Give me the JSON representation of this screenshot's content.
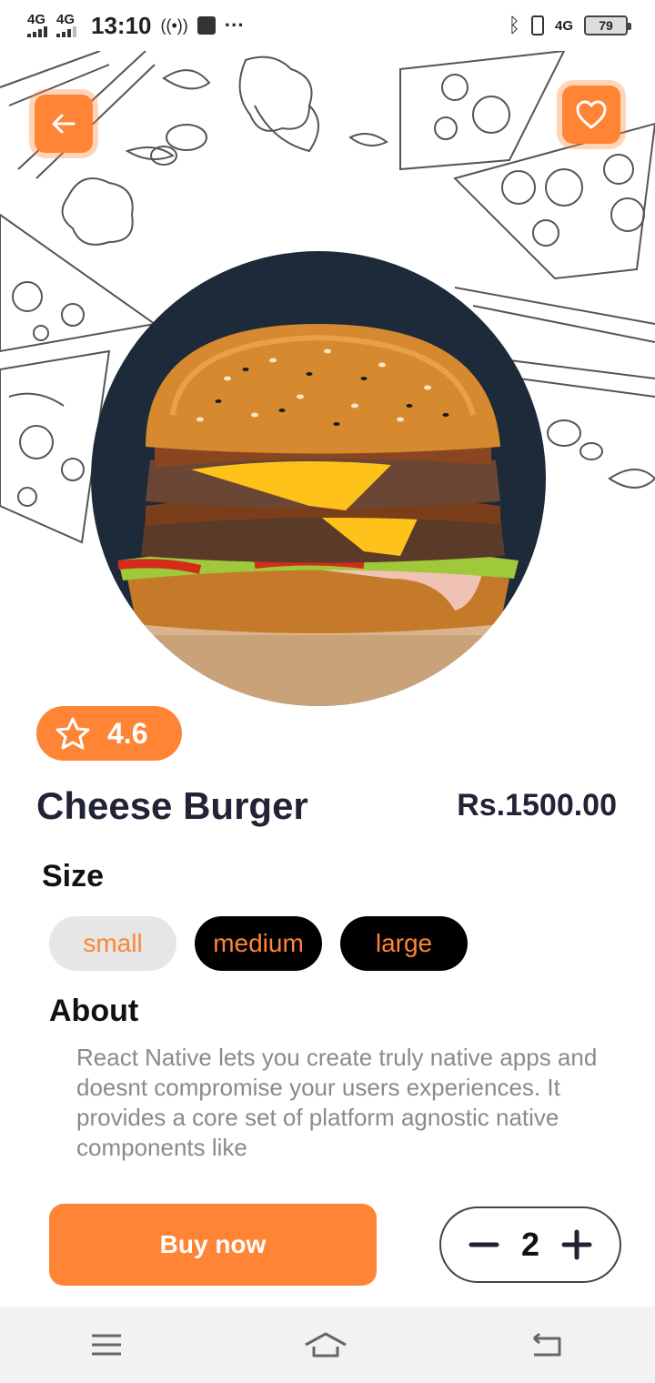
{
  "status_bar": {
    "network_1": "4G",
    "network_2": "4G",
    "time": "13:10",
    "network_3": "4G",
    "battery": "79"
  },
  "product": {
    "rating": "4.6",
    "name": "Cheese Burger",
    "price": "Rs.1500.00"
  },
  "size": {
    "label": "Size",
    "options": [
      "small",
      "medium",
      "large"
    ],
    "selected": "small"
  },
  "about": {
    "label": "About",
    "text": "React Native lets you create truly native apps and doesnt compromise your users experiences. It provides a core set of platform agnostic native components like"
  },
  "actions": {
    "buy_label": "Buy now",
    "quantity": "2"
  },
  "colors": {
    "accent": "#ff8435",
    "text_dark": "#232338",
    "chip_dark": "#000000",
    "chip_selected": "#e6e6e6"
  },
  "icons": {
    "back": "arrow-left-icon",
    "favorite": "heart-icon",
    "rating": "star-icon",
    "minus": "minus-icon",
    "plus": "plus-icon",
    "nav_menu": "menu-icon",
    "nav_home": "home-icon",
    "nav_back": "back-icon"
  }
}
